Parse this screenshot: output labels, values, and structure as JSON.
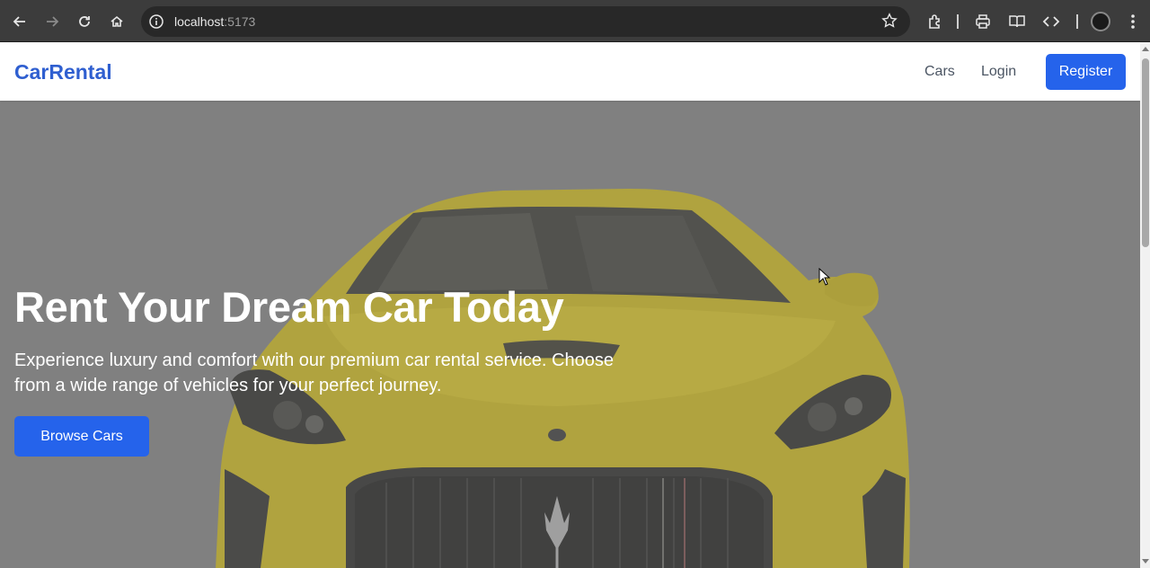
{
  "browser": {
    "url_host": "localhost",
    "url_port": ":5173",
    "icons": [
      "back-icon",
      "forward-icon",
      "reload-icon",
      "home-icon",
      "site-info-icon",
      "bookmark-star-icon",
      "extensions-icon",
      "print-icon",
      "reading-mode-icon",
      "devtools-icon",
      "profile-avatar",
      "menu-icon"
    ]
  },
  "navbar": {
    "brand": "CarRental",
    "links": {
      "cars": "Cars",
      "login": "Login"
    },
    "register_label": "Register"
  },
  "hero": {
    "title": "Rent Your Dream Car Today",
    "description": "Experience luxury and comfort with our premium car rental service. Choose from a wide range of vehicles for your perfect journey.",
    "cta_label": "Browse Cars"
  },
  "colors": {
    "brand": "#2f5fd0",
    "primary_button": "#2563eb",
    "hero_overlay": "#808080",
    "car": "#f2d21a"
  }
}
